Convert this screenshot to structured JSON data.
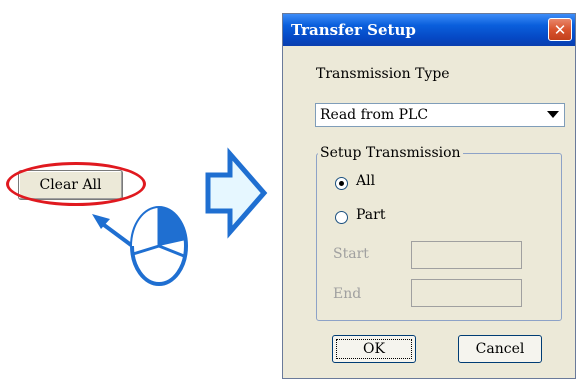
{
  "left": {
    "clear_all_label": "Clear All"
  },
  "dialog": {
    "title": "Transfer Setup",
    "close_symbol": "✕",
    "transmission_type_label": "Transmission Type",
    "transmission_type_value": "Read from PLC",
    "setup_group_label": "Setup Transmission",
    "option_all_label": "All",
    "option_part_label": "Part",
    "selected_option": "All",
    "start_label": "Start",
    "end_label": "End",
    "ok_label": "OK",
    "cancel_label": "Cancel"
  },
  "icons": [
    "mouse-click-icon",
    "right-arrow-icon",
    "dropdown-arrow-icon",
    "close-icon"
  ],
  "colors": {
    "highlight_red": "#e0191f",
    "arrow_blue": "#1f6fd1",
    "arrow_fill": "#e6f7ff",
    "titlebar_blue": "#0a5fdc",
    "dialog_bg": "#ece9d8"
  }
}
